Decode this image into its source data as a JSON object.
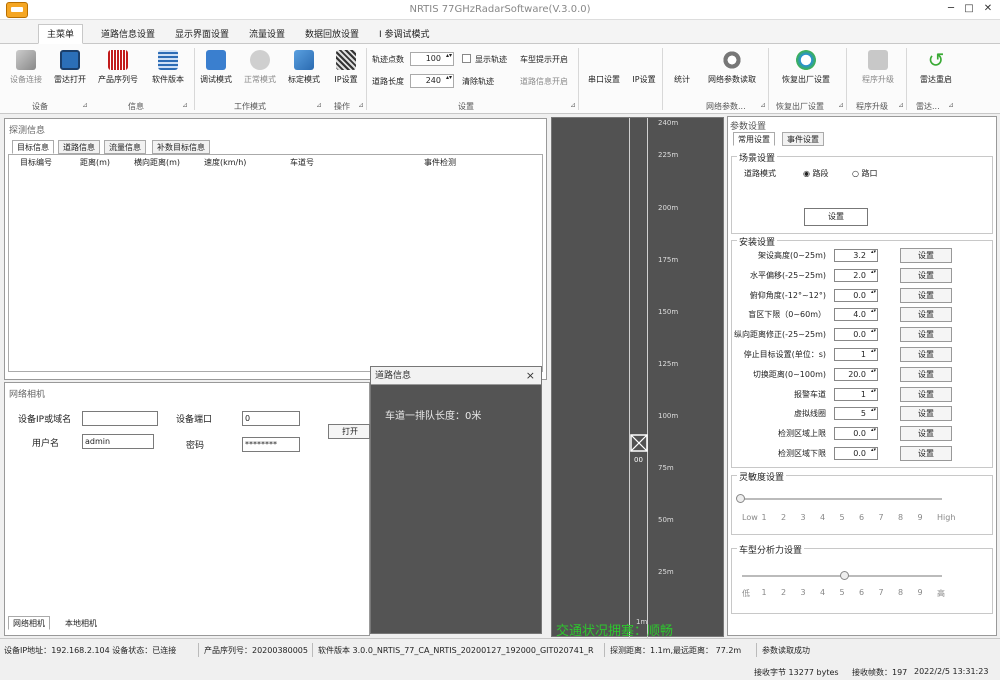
{
  "window": {
    "title": "NRTIS 77GHzRadarSoftware(V.3.0.0)",
    "controls": [
      "─",
      "□",
      "✕"
    ]
  },
  "ribbon_tabs": [
    "主菜单",
    "道路信息设置",
    "显示界面设置",
    "流量设置",
    "数据回放设置",
    "I 参调试模式"
  ],
  "ribbon": {
    "buttons": {
      "dev_connect": "设备连接",
      "radar_open": "雷达打开",
      "product_serial": "产品序列号",
      "software_version": "软件版本",
      "debug_mode": "调试模式",
      "normal_mode": "正常模式",
      "calib_mode": "标定模式",
      "ip_settings_a": "IP设置",
      "serial_settings": "串口设置",
      "ip_settings_b": "IP设置",
      "count_btn": "统计",
      "net_params": "网络参数读取",
      "factory_reset": "恢复出厂设置",
      "firmware_upgrade": "程序升级",
      "reboot": "雷达重启"
    },
    "fields": {
      "track_point_label": "轨迹点数",
      "track_point_value": "100",
      "road_length_label": "道路长度",
      "road_length_value": "240",
      "show_track_label": "显示轨迹",
      "clear_track_label": "清除轨迹",
      "lane_prompt_open": "车型提示开启",
      "lane_prompt_off": "道路信息开启"
    },
    "groups": [
      "设备",
      "信息",
      "工作模式",
      "操作",
      "设置",
      "网络参数...",
      "恢复出厂设置",
      "程序升级",
      "雷达..."
    ]
  },
  "left_panel": {
    "title": "探测信息",
    "tabs": [
      "目标信息",
      "道路信息",
      "流量信息",
      "补数目标信息"
    ],
    "columns": [
      "目标编号",
      "距离(m)",
      "横向距离(m)",
      "速度(km/h)",
      "车道号",
      "事件检测"
    ]
  },
  "network_panel": {
    "title": "网络相机",
    "ip_label": "设备IP或域名",
    "ip_value": "",
    "port_label": "设备端口",
    "port_value": "0",
    "user_label": "用户名",
    "user_value": "admin",
    "pwd_label": "密码",
    "pwd_value": "********",
    "open_button": "打开",
    "bottom_tabs": [
      "网络相机",
      "本地相机"
    ]
  },
  "popup": {
    "title": "道路信息",
    "body": "车道一排队长度：0米"
  },
  "road": {
    "ticks": [
      "240m",
      "225m",
      "200m",
      "175m",
      "150m",
      "125m",
      "100m",
      "75m",
      "50m",
      "25m",
      "1m"
    ],
    "target_label": "00",
    "status": "交通状况拥塞：顺畅"
  },
  "right_panel": {
    "title": "参数设置",
    "tabs": [
      "常用设置",
      "事件设置"
    ],
    "scene_group": "场景设置",
    "road_mode_label": "道路模式",
    "road_mode_options": [
      "路段",
      "路口"
    ],
    "scene_set_button": "设置",
    "install_group": "安装设置",
    "rows": [
      {
        "label": "架设高度(0~25m)",
        "value": "3.2",
        "button": "设置"
      },
      {
        "label": "水平偏移(-25~25m)",
        "value": "2.0",
        "button": "设置"
      },
      {
        "label": "俯仰角度(-12°~12°)",
        "value": "0.0",
        "button": "设置"
      },
      {
        "label": "盲区下限（0~60m）",
        "value": "4.0",
        "button": "设置"
      },
      {
        "label": "纵向距离修正(-25~25m)",
        "value": "0.0",
        "button": "设置"
      },
      {
        "label": "停止目标设置(单位：s)",
        "value": "1",
        "button": "设置"
      },
      {
        "label": "切换距离(0~100m)",
        "value": "20.0",
        "button": "设置"
      },
      {
        "label": "报警车道",
        "value": "1",
        "button": "设置"
      },
      {
        "label": "虚拟线圈",
        "value": "5",
        "button": "设置"
      },
      {
        "label": "检测区域上限",
        "value": "0.0",
        "button": "设置"
      },
      {
        "label": "检测区域下限",
        "value": "0.0",
        "button": "设置"
      }
    ],
    "sensitivity_group": "灵敏度设置",
    "sensitivity_labels": [
      "Low",
      "1",
      "2",
      "3",
      "4",
      "5",
      "6",
      "7",
      "8",
      "9",
      "High"
    ],
    "vehicle_group": "车型分析力设置",
    "vehicle_labels": [
      "低",
      "1",
      "2",
      "3",
      "4",
      "5",
      "6",
      "7",
      "8",
      "9",
      "高"
    ]
  },
  "statusbar": {
    "device_ip": "设备IP地址：",
    "device_ip_value": "192.168.2.104",
    "dev_state": "设备状态：已连接",
    "serial": "产品序列号：",
    "serial_value": "20200380005",
    "sw_version": "软件版本",
    "sw_version_value": "3.0.0_NRTIS_77_CA_NRTIS_20200127_192000_GIT020741_R",
    "detect_distance": "探测距离：",
    "detect_distance_value": "1.1m,最远距离：",
    "max_distance_value": "77.2m",
    "param_status": "参数读取成功",
    "recv_bytes": "接收字节",
    "recv_bytes_value": "13277 bytes",
    "recv_frames": "接收帧数：",
    "recv_frames_value": "197",
    "datetime": "2022/2/5 13:31:23"
  }
}
